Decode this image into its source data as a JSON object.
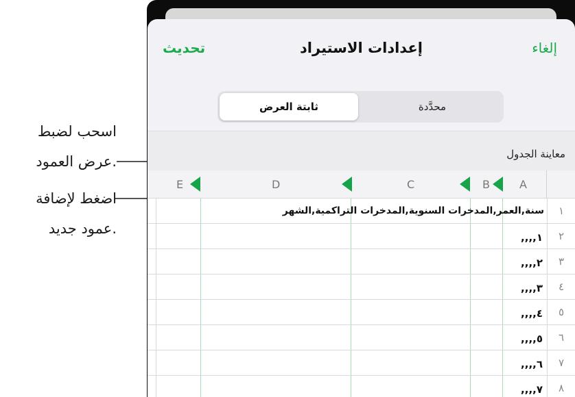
{
  "callouts": {
    "drag_line1": "اسحب لضبط",
    "drag_line2": "عرض العمود.",
    "tap_line1": "اضغط لإضافة",
    "tap_line2": "عمود جديد."
  },
  "nav": {
    "update": "تحديث",
    "title": "إعدادات الاستيراد",
    "cancel": "إلغاء"
  },
  "segmented": {
    "fixed_width": "ثابتة العرض",
    "delimited": "محدَّدة"
  },
  "section": {
    "label": "معاينة الجدول"
  },
  "columns": [
    "A",
    "B",
    "C",
    "D",
    "E"
  ],
  "rows": [
    {
      "num": "١",
      "text": "سنة,العمر,المدخرات  السنوية,المدخرات  التراكمية,الشهر"
    },
    {
      "num": "٢",
      "text": ",,,,١"
    },
    {
      "num": "٣",
      "text": ",,,,٢"
    },
    {
      "num": "٤",
      "text": ",,,,٣"
    },
    {
      "num": "٥",
      "text": ",,,,٤"
    },
    {
      "num": "٦",
      "text": ",,,,٥"
    },
    {
      "num": "٧",
      "text": ",,,,٦"
    },
    {
      "num": "٨",
      "text": ",,,,٧"
    }
  ],
  "colors": {
    "accent": "#1bab4b",
    "handle": "#16a34a",
    "divider_line": "#a7dcb6"
  },
  "icons": {
    "column_handle": "triangle-left-icon"
  }
}
